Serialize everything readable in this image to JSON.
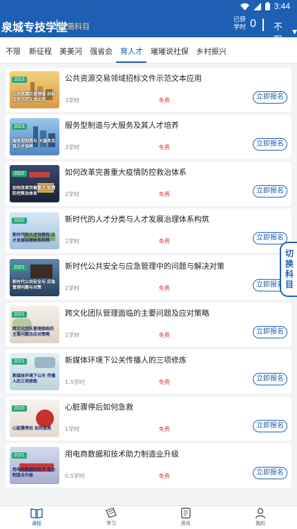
{
  "status": {
    "time": "3:44"
  },
  "header": {
    "brand": "泉城专技学堂",
    "brand_sub": "公需科目",
    "hours_label": "已获学时",
    "hours_value": "0",
    "filter_label": "不限"
  },
  "tabs": [
    {
      "label": "不限",
      "active": false
    },
    {
      "label": "新征程",
      "active": false
    },
    {
      "label": "美美河",
      "active": false
    },
    {
      "label": "强省会",
      "active": false
    },
    {
      "label": "育人才",
      "active": true
    },
    {
      "label": "璀璀说社保",
      "active": false
    },
    {
      "label": "乡村振兴",
      "active": false
    }
  ],
  "courses": [
    {
      "year": "2023",
      "title": "公共资源交易领域招标文件示范文本应用",
      "hours": "3学时",
      "price": "免费",
      "button": "立即报名",
      "thumb_caption": "公共资源交易领域 招标文件示范文本应用",
      "thumb_color": "#e4b465"
    },
    {
      "year": "2023",
      "title": "服务型制造与大服务及其人才培养",
      "hours": "3学时",
      "price": "免费",
      "button": "立即报名",
      "thumb_caption": "服务型制造与 大服务及其人才培养",
      "thumb_color": "#6ea3cf"
    },
    {
      "year": "2022",
      "title": "如何改革完善重大疫情防控救治体系",
      "hours": "2学时",
      "price": "免费",
      "button": "立即报名",
      "thumb_caption": "如何改革完善重大 疫情防控救治体系",
      "thumb_color": "#2f3550"
    },
    {
      "year": "2022",
      "title": "新时代的人才分类与人才发展治理体系构筑",
      "hours": "2学时",
      "price": "免费",
      "button": "立即报名",
      "thumb_caption": "新时代的人才分类与 人才发展治理体系构筑",
      "thumb_color": "#b9d2e8"
    },
    {
      "year": "2021",
      "title": "新时代公共安全与应急管理中的问题与解决对策",
      "hours": "2学时",
      "price": "免费",
      "button": "立即报名",
      "thumb_caption": "新时代公共安全与 应急管理问题与对策",
      "thumb_color": "#355a7a"
    },
    {
      "year": "2021",
      "title": "跨文化团队管理面临的主要问题及应对策略",
      "hours": "2学时",
      "price": "免费",
      "button": "立即报名",
      "thumb_caption": "跨文化团队管理面临的 主要问题及应对策略",
      "thumb_color": "#ece6dc"
    },
    {
      "year": "2021",
      "title": "新媒体环境下公关传播人的三项修炼",
      "hours": "1.5学时",
      "price": "免费",
      "button": "立即报名",
      "thumb_caption": "新媒体环境下公关 传播人的三项修炼",
      "thumb_color": "#d8e6ec"
    },
    {
      "year": "2020",
      "title": "心脏骤停后如何急救",
      "hours": "1学时",
      "price": "免费",
      "button": "立即报名",
      "thumb_caption": "心脏骤停后 如何急救",
      "thumb_color": "#f2eeea"
    },
    {
      "year": "2021",
      "title": "用电商数据和技术助力制造业升级",
      "hours": "0.5学时",
      "price": "免费",
      "button": "立即报名",
      "thumb_caption": "用电商数据和技术 助力制造业升级",
      "thumb_color": "#c7cbe0"
    }
  ],
  "side_switch": "切换科目",
  "bottom_nav": [
    {
      "label": "课程",
      "icon": "book-icon",
      "active": true
    },
    {
      "label": "学习",
      "icon": "study-icon",
      "active": false
    },
    {
      "label": "资讯",
      "icon": "news-icon",
      "active": false
    },
    {
      "label": "我的",
      "icon": "person-icon",
      "active": false
    }
  ],
  "colors": {
    "primary": "#1d5fb3",
    "free": "#d83b3b",
    "year_badge": "#2aa57a"
  }
}
